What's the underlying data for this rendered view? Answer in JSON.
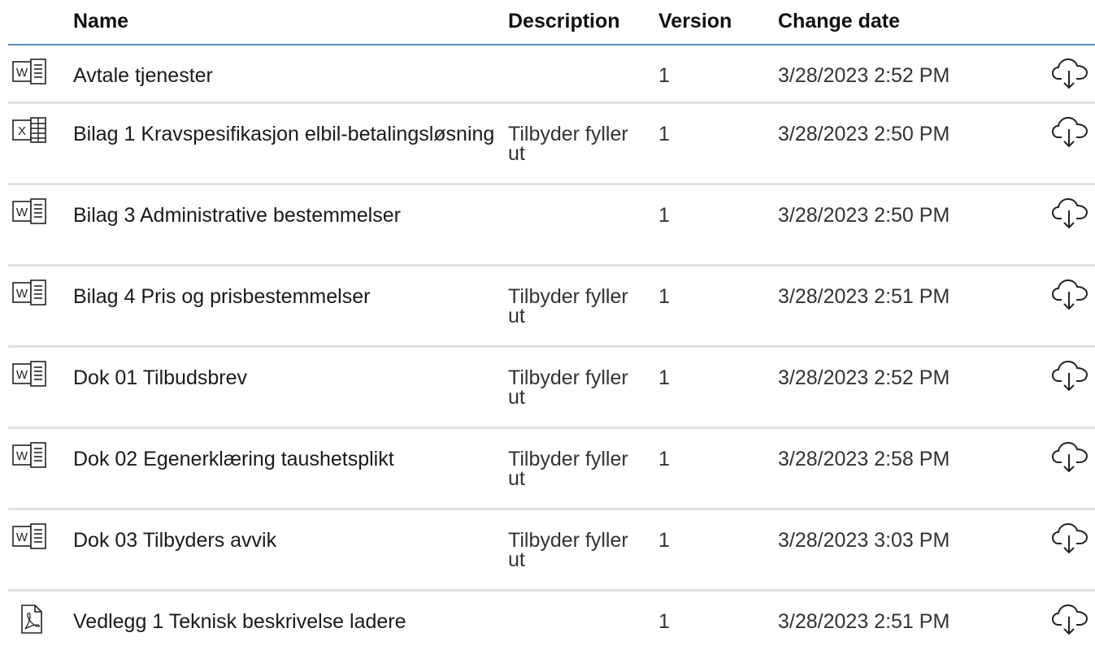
{
  "header": {
    "name": "Name",
    "description": "Description",
    "version": "Version",
    "change_date": "Change date"
  },
  "rows": [
    {
      "type": "word",
      "name": "Avtale tjenester",
      "description": "",
      "version": "1",
      "date": "3/28/2023 2:52 PM"
    },
    {
      "type": "excel",
      "name": "Bilag 1 Kravspesifikasjon elbil-betalingsløsning",
      "description": "Tilbyder fyller ut",
      "version": "1",
      "date": "3/28/2023 2:50 PM"
    },
    {
      "type": "word",
      "name": "Bilag 3 Administrative bestemmelser",
      "description": "",
      "version": "1",
      "date": "3/28/2023 2:50 PM"
    },
    {
      "type": "word",
      "name": "Bilag 4 Pris og prisbestemmelser",
      "description": "Tilbyder fyller ut",
      "version": "1",
      "date": "3/28/2023 2:51 PM"
    },
    {
      "type": "word",
      "name": "Dok 01 Tilbudsbrev",
      "description": "Tilbyder fyller ut",
      "version": "1",
      "date": "3/28/2023 2:52 PM"
    },
    {
      "type": "word",
      "name": "Dok 02 Egenerklæring taushetsplikt",
      "description": "Tilbyder fyller ut",
      "version": "1",
      "date": "3/28/2023 2:58 PM"
    },
    {
      "type": "word",
      "name": "Dok 03 Tilbyders avvik",
      "description": "Tilbyder fyller ut",
      "version": "1",
      "date": "3/28/2023 3:03 PM"
    },
    {
      "type": "pdf",
      "name": "Vedlegg 1 Teknisk beskrivelse ladere",
      "description": "",
      "version": "1",
      "date": "3/28/2023 2:51 PM"
    }
  ],
  "icons": {
    "word": "word-file-icon",
    "excel": "excel-file-icon",
    "pdf": "pdf-file-icon",
    "download": "cloud-download-icon"
  }
}
